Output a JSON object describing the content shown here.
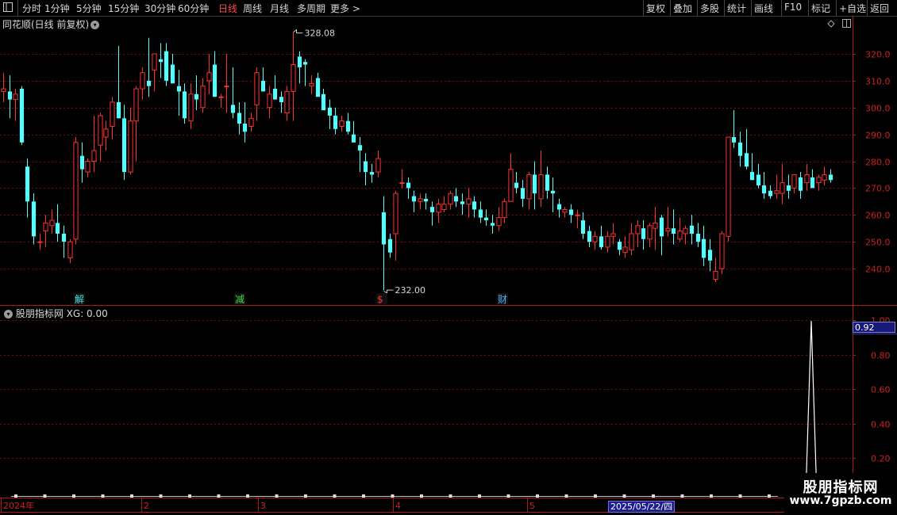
{
  "toolbar": {
    "periods": [
      "分时",
      "1分钟",
      "5分钟",
      "15分钟",
      "30分钟",
      "60分钟",
      "日线",
      "周线",
      "月线",
      "多周期",
      "更多 >"
    ],
    "active_period": "日线",
    "actions": [
      "复权",
      "叠加",
      "多股",
      "统计",
      "画线",
      "F10",
      "标记",
      "+自选",
      "返回"
    ]
  },
  "main_chart": {
    "title": "同花顺(日线 前复权)",
    "y_ticks": [
      "320.0",
      "310.0",
      "300.0",
      "290.0",
      "280.0",
      "270.0",
      "260.0",
      "250.0",
      "240.0"
    ],
    "max_label": "328.08",
    "min_label": "232.00",
    "markers": [
      {
        "text": "解",
        "color": "#40e0e0"
      },
      {
        "text": "减",
        "color": "#40e040"
      },
      {
        "text": "$",
        "color": "#ff3030"
      },
      {
        "text": "财",
        "color": "#50b0ff"
      }
    ]
  },
  "indicator": {
    "title": "股朋指标网",
    "value_text": "XG: 0.00",
    "y_ticks": [
      "1.00",
      "0.80",
      "0.60",
      "0.40",
      "0.20"
    ],
    "current_value": "0.92"
  },
  "time_axis": {
    "labels": [
      "2024年",
      "2",
      "3",
      "4",
      "5"
    ],
    "selected_date": "2025/05/22/四"
  },
  "watermark": {
    "title": "股朋指标网",
    "url": "www.7gpzb.com"
  },
  "colors": {
    "up": "#ff3232",
    "down": "#54ffff",
    "grid": "#7a1010",
    "axis": "#b01818",
    "background": "#000000"
  },
  "chart_data": {
    "type": "candlestick",
    "ylim": [
      235,
      330
    ],
    "ohlc": [
      [
        306,
        313,
        302,
        307
      ],
      [
        306,
        312,
        296,
        303
      ],
      [
        303,
        307,
        295,
        305
      ],
      [
        307,
        308,
        286,
        287
      ],
      [
        278,
        281,
        259,
        265
      ],
      [
        265,
        268,
        249,
        252
      ],
      [
        250,
        253,
        247,
        250
      ],
      [
        254,
        260,
        248,
        257
      ],
      [
        256,
        262,
        253,
        258
      ],
      [
        257,
        264,
        250,
        253
      ],
      [
        253,
        256,
        244,
        250
      ],
      [
        244,
        251,
        242,
        250
      ],
      [
        251,
        289,
        249,
        287
      ],
      [
        282,
        287,
        272,
        277
      ],
      [
        276,
        281,
        274,
        280
      ],
      [
        280,
        297,
        276,
        284
      ],
      [
        286,
        298,
        280,
        297
      ],
      [
        289,
        295,
        284,
        292
      ],
      [
        293,
        304,
        288,
        302
      ],
      [
        302,
        323,
        296,
        296
      ],
      [
        296,
        301,
        273,
        276
      ],
      [
        276,
        300,
        275,
        295
      ],
      [
        295,
        308,
        280,
        307
      ],
      [
        307,
        315,
        303,
        313
      ],
      [
        310,
        326,
        304,
        308
      ],
      [
        314,
        320,
        306,
        320
      ],
      [
        318,
        324,
        311,
        317
      ],
      [
        321,
        324,
        308,
        310
      ],
      [
        316,
        320,
        309,
        309
      ],
      [
        308,
        314,
        297,
        306
      ],
      [
        306,
        309,
        294,
        296
      ],
      [
        295,
        309,
        292,
        305
      ],
      [
        305,
        312,
        299,
        303
      ],
      [
        300,
        311,
        298,
        308
      ],
      [
        310,
        320,
        305,
        313
      ],
      [
        316,
        321,
        304,
        304
      ],
      [
        304,
        305,
        300,
        304
      ],
      [
        308,
        320,
        298,
        308
      ],
      [
        301,
        315,
        296,
        298
      ],
      [
        298,
        302,
        290,
        294
      ],
      [
        294,
        302,
        287,
        291
      ],
      [
        293,
        298,
        291,
        296
      ],
      [
        301,
        315,
        295,
        313
      ],
      [
        310,
        315,
        307,
        306
      ],
      [
        300,
        308,
        296,
        305
      ],
      [
        307,
        312,
        303,
        303
      ],
      [
        304,
        306,
        298,
        302
      ],
      [
        298,
        308,
        295,
        306
      ],
      [
        306,
        328,
        295,
        316
      ],
      [
        319,
        321,
        309,
        315
      ],
      [
        317,
        318,
        308,
        316
      ],
      [
        308,
        312,
        305,
        309
      ],
      [
        311,
        313,
        304,
        304
      ],
      [
        305,
        307,
        299,
        299
      ],
      [
        300,
        303,
        292,
        297
      ],
      [
        297,
        300,
        290,
        292
      ],
      [
        293,
        297,
        291,
        295
      ],
      [
        295,
        298,
        290,
        291
      ],
      [
        290,
        295,
        287,
        287
      ],
      [
        286,
        289,
        276,
        284
      ],
      [
        280,
        283,
        271,
        276
      ],
      [
        276,
        279,
        272,
        275
      ],
      [
        276,
        284,
        274,
        281
      ],
      [
        261,
        267,
        232,
        249
      ],
      [
        251,
        253,
        244,
        246
      ],
      [
        253,
        269,
        243,
        268
      ],
      [
        272,
        277,
        270,
        272
      ],
      [
        272,
        274,
        266,
        270
      ],
      [
        267,
        269,
        261,
        265
      ],
      [
        265,
        268,
        262,
        266
      ],
      [
        266,
        268,
        262,
        265
      ],
      [
        263,
        265,
        256,
        261
      ],
      [
        261,
        266,
        257,
        264
      ],
      [
        262,
        267,
        261,
        264
      ],
      [
        264,
        269,
        262,
        268
      ],
      [
        267,
        270,
        263,
        265
      ],
      [
        265,
        268,
        260,
        264
      ],
      [
        264,
        270,
        259,
        266
      ],
      [
        265,
        267,
        259,
        262
      ],
      [
        262,
        265,
        257,
        259
      ],
      [
        259,
        262,
        256,
        258
      ],
      [
        257,
        260,
        253,
        256
      ],
      [
        256,
        263,
        254,
        259
      ],
      [
        259,
        266,
        257,
        265
      ],
      [
        265,
        283,
        265,
        277
      ],
      [
        272,
        276,
        268,
        270
      ],
      [
        270,
        273,
        263,
        266
      ],
      [
        266,
        276,
        262,
        275
      ],
      [
        275,
        280,
        262,
        268
      ],
      [
        266,
        284,
        263,
        275
      ],
      [
        275,
        278,
        266,
        269
      ],
      [
        269,
        274,
        261,
        268
      ],
      [
        264,
        266,
        259,
        262
      ],
      [
        261,
        263,
        259,
        262
      ],
      [
        262,
        264,
        257,
        260
      ],
      [
        260,
        262,
        255,
        260
      ],
      [
        258,
        261,
        251,
        253
      ],
      [
        254,
        256,
        248,
        250
      ],
      [
        250,
        254,
        247,
        252
      ],
      [
        252,
        256,
        247,
        248
      ],
      [
        248,
        254,
        246,
        252
      ],
      [
        252,
        257,
        249,
        253
      ],
      [
        250,
        251,
        245,
        247
      ],
      [
        246,
        252,
        244,
        248
      ],
      [
        247,
        257,
        245,
        253
      ],
      [
        253,
        258,
        248,
        256
      ],
      [
        255,
        258,
        247,
        251
      ],
      [
        251,
        257,
        248,
        256
      ],
      [
        255,
        263,
        247,
        257
      ],
      [
        259,
        260,
        245,
        252
      ],
      [
        254,
        263,
        252,
        255
      ],
      [
        255,
        262,
        249,
        253
      ],
      [
        251,
        259,
        250,
        254
      ],
      [
        253,
        256,
        249,
        255
      ],
      [
        256,
        260,
        249,
        253
      ],
      [
        253,
        257,
        248,
        250
      ],
      [
        251,
        256,
        241,
        244
      ],
      [
        247,
        251,
        239,
        243
      ],
      [
        236,
        244,
        235,
        239
      ],
      [
        240,
        254,
        238,
        253
      ],
      [
        252,
        276,
        250,
        289
      ],
      [
        289,
        299,
        285,
        287
      ],
      [
        287,
        291,
        278,
        282
      ],
      [
        283,
        292,
        277,
        278
      ],
      [
        276,
        283,
        273,
        273
      ],
      [
        275,
        279,
        270,
        271
      ],
      [
        271,
        276,
        266,
        268
      ],
      [
        269,
        271,
        266,
        267
      ],
      [
        268,
        275,
        266,
        269
      ],
      [
        268,
        279,
        264,
        272
      ],
      [
        271,
        275,
        266,
        269
      ],
      [
        270,
        275,
        268,
        275
      ],
      [
        274,
        276,
        266,
        269
      ],
      [
        272,
        279,
        269,
        275
      ],
      [
        274,
        277,
        271,
        270
      ],
      [
        272,
        275,
        269,
        274
      ],
      [
        273,
        278,
        271,
        275
      ],
      [
        275,
        277,
        272,
        273
      ]
    ]
  }
}
